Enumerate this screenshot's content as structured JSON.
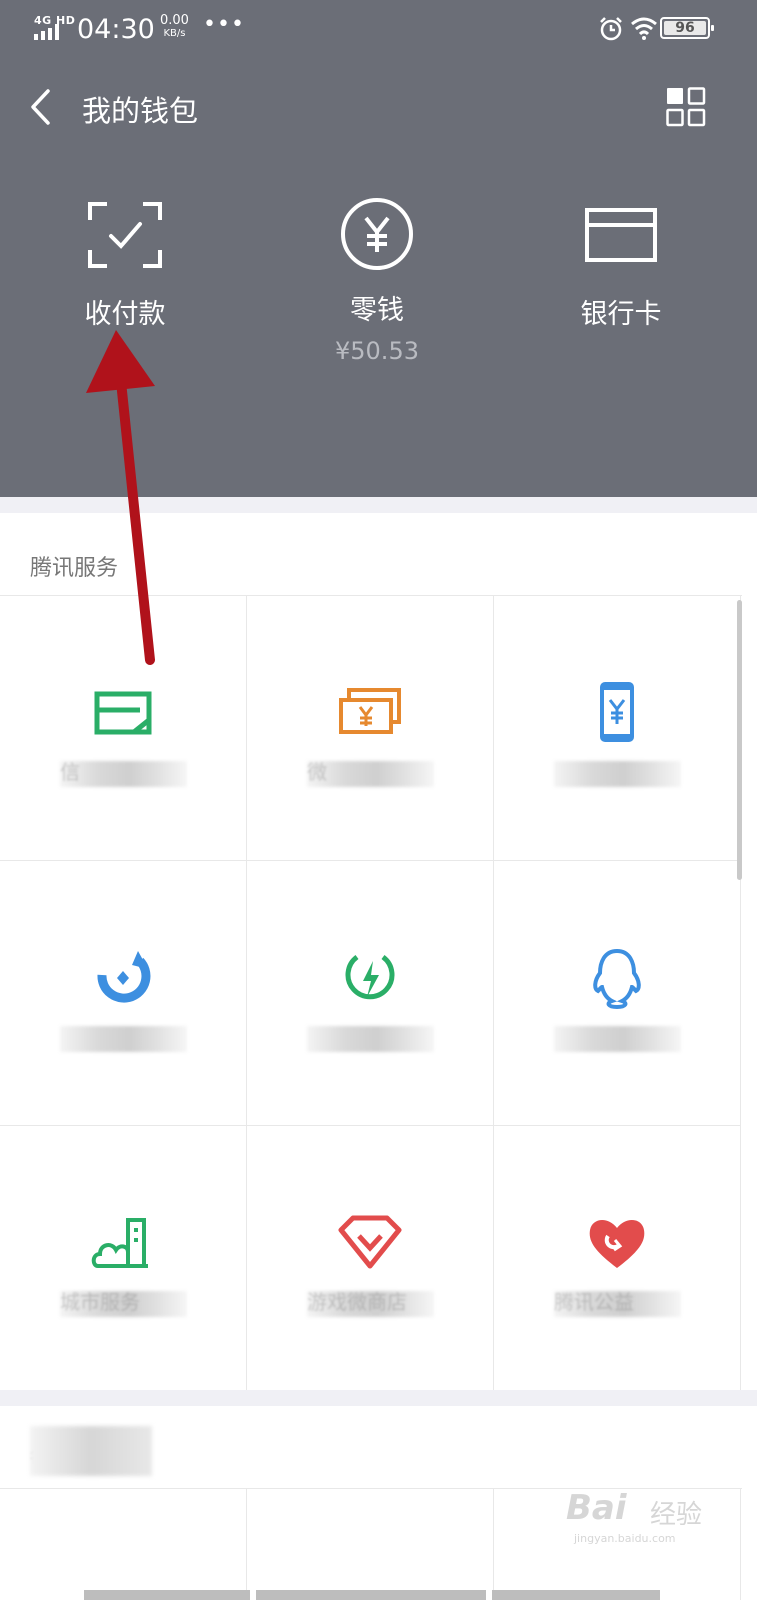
{
  "status_bar": {
    "network": "4G HD",
    "time": "04:30",
    "speed_value": "0.00",
    "speed_unit": "KB/s",
    "more": "•••",
    "battery": "96"
  },
  "navbar": {
    "title": "我的钱包",
    "back_icon": "chevron-left-icon",
    "menu_icon": "grid-icon"
  },
  "actions": [
    {
      "label": "收付款",
      "icon": "scan-check-icon"
    },
    {
      "label": "零钱",
      "value": "¥50.53",
      "icon": "yen-circle-icon"
    },
    {
      "label": "银行卡",
      "icon": "card-icon"
    }
  ],
  "sections": {
    "tencent_title": "腾讯服务",
    "second_title": "每"
  },
  "services": [
    {
      "label": "信",
      "icon": "credit-card-icon",
      "color": "#2aae67"
    },
    {
      "label": "微",
      "icon": "money-icon",
      "color": "#e6892f"
    },
    {
      "label": "",
      "icon": "phone-yen-icon",
      "color": "#3d8fe0"
    },
    {
      "label": "",
      "icon": "wealth-icon",
      "color": "#3d8fe0"
    },
    {
      "label": "",
      "icon": "charge-icon",
      "color": "#2aae67"
    },
    {
      "label": "",
      "icon": "qq-icon",
      "color": "#3d8fe0"
    },
    {
      "label": "城市服务",
      "icon": "city-icon",
      "color": "#2aae67"
    },
    {
      "label": "游戏微商店",
      "icon": "diamond-icon",
      "color": "#e24c4c"
    },
    {
      "label": "腾讯公益",
      "icon": "heart-icon",
      "color": "#e24c4c"
    }
  ],
  "watermark": {
    "brand": "Bai",
    "brand2": "经验",
    "url": "jingyan.baidu.com"
  },
  "colors": {
    "header_bg": "#6b6e77",
    "arrow": "#b0121b"
  }
}
